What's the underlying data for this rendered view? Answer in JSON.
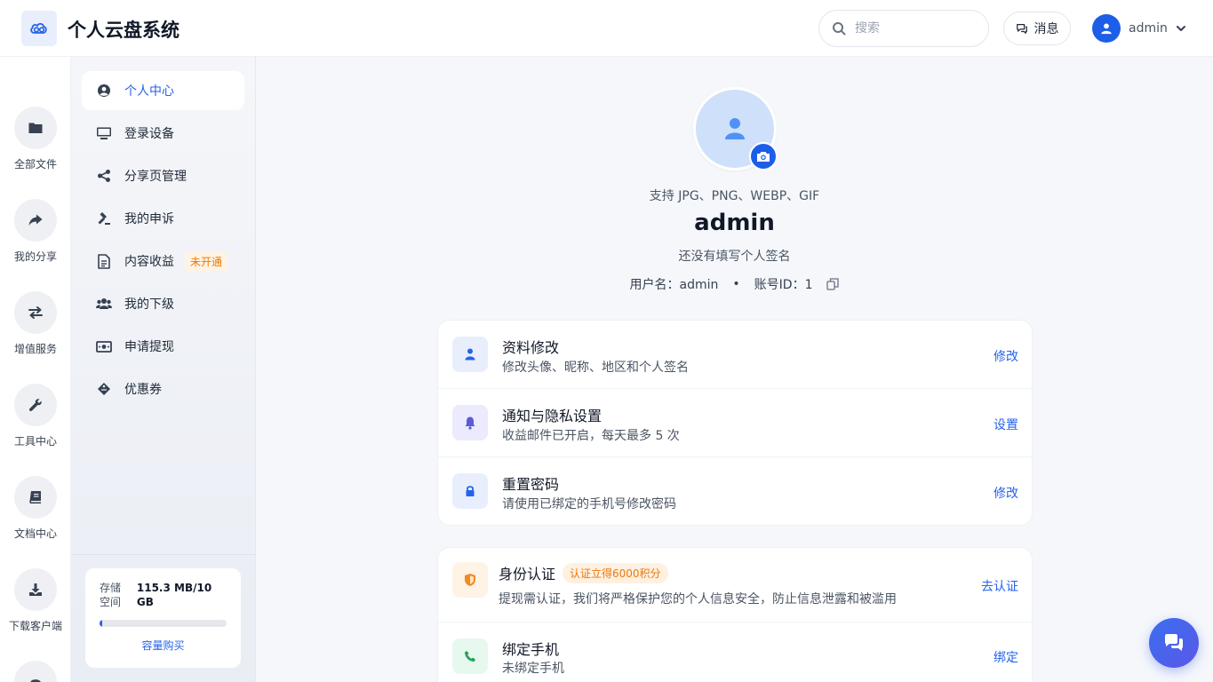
{
  "header": {
    "app_title": "个人云盘系统",
    "search_placeholder": "搜索",
    "messages_label": "消息",
    "user_name": "admin"
  },
  "rail": {
    "items": [
      {
        "label": "全部文件",
        "icon": "folder-icon"
      },
      {
        "label": "我的分享",
        "icon": "share-arrow-icon"
      },
      {
        "label": "增值服务",
        "icon": "exchange-icon"
      },
      {
        "label": "工具中心",
        "icon": "wrench-icon"
      },
      {
        "label": "文档中心",
        "icon": "book-icon"
      },
      {
        "label": "下载客户端",
        "icon": "download-icon"
      }
    ]
  },
  "subnav": {
    "items": [
      {
        "label": "个人中心",
        "icon": "user-circle-icon",
        "active": true
      },
      {
        "label": "登录设备",
        "icon": "monitor-icon"
      },
      {
        "label": "分享页管理",
        "icon": "share-nodes-icon"
      },
      {
        "label": "我的申诉",
        "icon": "gavel-icon"
      },
      {
        "label": "内容收益",
        "icon": "document-icon",
        "badge": "未开通"
      },
      {
        "label": "我的下级",
        "icon": "users-icon"
      },
      {
        "label": "申请提现",
        "icon": "money-icon"
      },
      {
        "label": "优惠券",
        "icon": "ticket-icon"
      }
    ]
  },
  "storage": {
    "label": "存储空间",
    "value": "115.3 MB/10 GB",
    "used_fraction": 0.011,
    "buy_label": "容量购买"
  },
  "profile": {
    "formats": "支持 JPG、PNG、WEBP、GIF",
    "name": "admin",
    "signature": "还没有填写个人签名",
    "username_text": "用户名：admin",
    "separator": "•",
    "account_id_text": "账号ID：1"
  },
  "settings": [
    {
      "title": "资料修改",
      "desc": "修改头像、昵称、地区和个人签名",
      "action": "修改",
      "icon": "user-icon"
    },
    {
      "title": "通知与隐私设置",
      "desc": "收益邮件已开启，每天最多 5 次",
      "action": "设置",
      "icon": "bell-icon"
    },
    {
      "title": "重置密码",
      "desc": "请使用已绑定的手机号修改密码",
      "action": "修改",
      "icon": "lock-icon"
    }
  ],
  "verification": [
    {
      "title": "身份认证",
      "badge": "认证立得6000积分",
      "desc": "提现需认证，我们将严格保护您的个人信息安全，防止信息泄露和被滥用",
      "action": "去认证",
      "icon": "shield-icon"
    },
    {
      "title": "绑定手机",
      "desc": "未绑定手机",
      "action": "绑定",
      "icon": "phone-icon"
    }
  ],
  "colors": {
    "accent": "#2563eb",
    "brand_blue": "#1d5ee8",
    "badge_orange": "#ea7a0c"
  }
}
